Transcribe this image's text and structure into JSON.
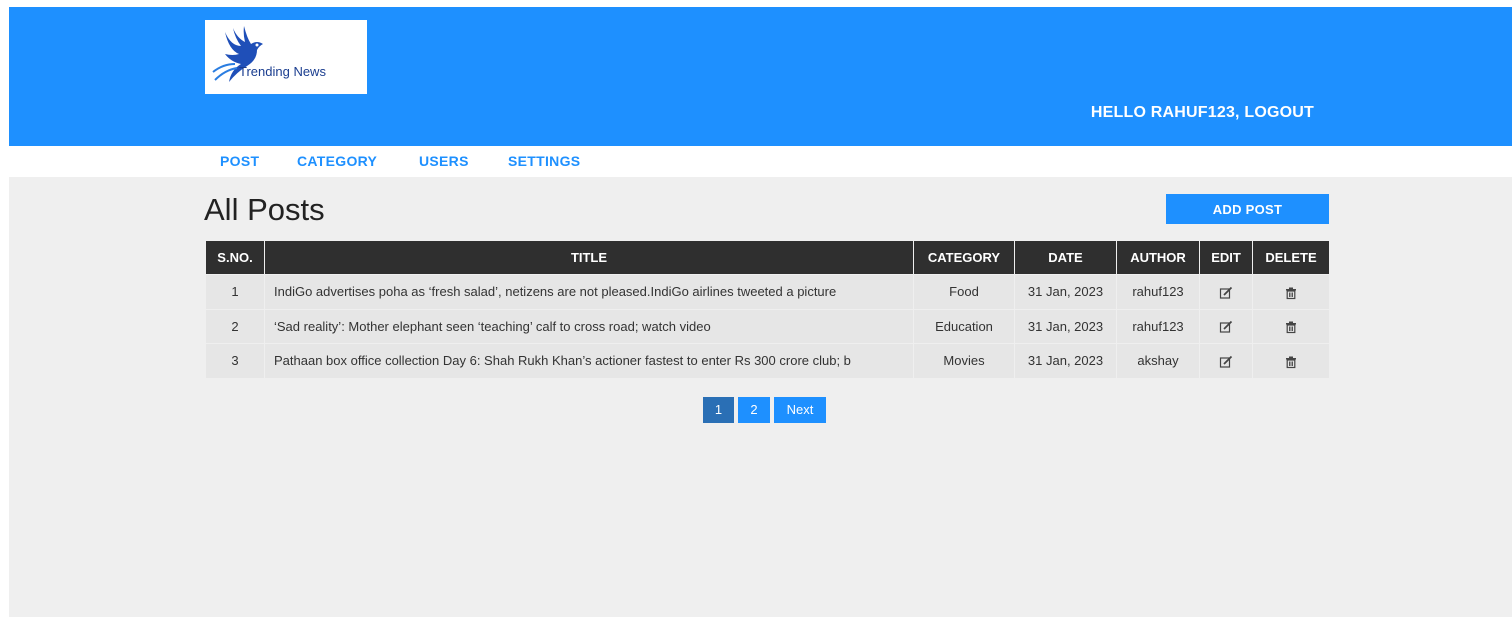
{
  "header": {
    "logo_text": "Trending News",
    "greeting": "HELLO RAHUF123, LOGOUT",
    "brand_color": "#1e90ff"
  },
  "menu": {
    "items": [
      {
        "label": "POST"
      },
      {
        "label": "CATEGORY"
      },
      {
        "label": "USERS"
      },
      {
        "label": "SETTINGS"
      }
    ]
  },
  "main": {
    "title": "All Posts",
    "add_button": "ADD POST"
  },
  "table": {
    "headers": [
      "S.NO.",
      "TITLE",
      "CATEGORY",
      "DATE",
      "AUTHOR",
      "EDIT",
      "DELETE"
    ],
    "rows": [
      {
        "sno": "1",
        "title": "IndiGo advertises poha as ‘fresh salad’, netizens are not pleased.IndiGo airlines tweeted a picture",
        "category": "Food",
        "date": "31 Jan, 2023",
        "author": "rahuf123"
      },
      {
        "sno": "2",
        "title": "‘Sad reality’: Mother elephant seen ‘teaching’ calf to cross road; watch video",
        "category": "Education",
        "date": "31 Jan, 2023",
        "author": "rahuf123"
      },
      {
        "sno": "3",
        "title": "Pathaan box office collection Day 6: Shah Rukh Khan’s actioner fastest to enter Rs 300 crore club; b",
        "category": "Movies",
        "date": "31 Jan, 2023",
        "author": "akshay"
      }
    ],
    "edit_icon": "edit-icon",
    "delete_icon": "trash-icon"
  },
  "pagination": {
    "pages": [
      "1",
      "2"
    ],
    "current": "1",
    "next_label": "Next"
  }
}
